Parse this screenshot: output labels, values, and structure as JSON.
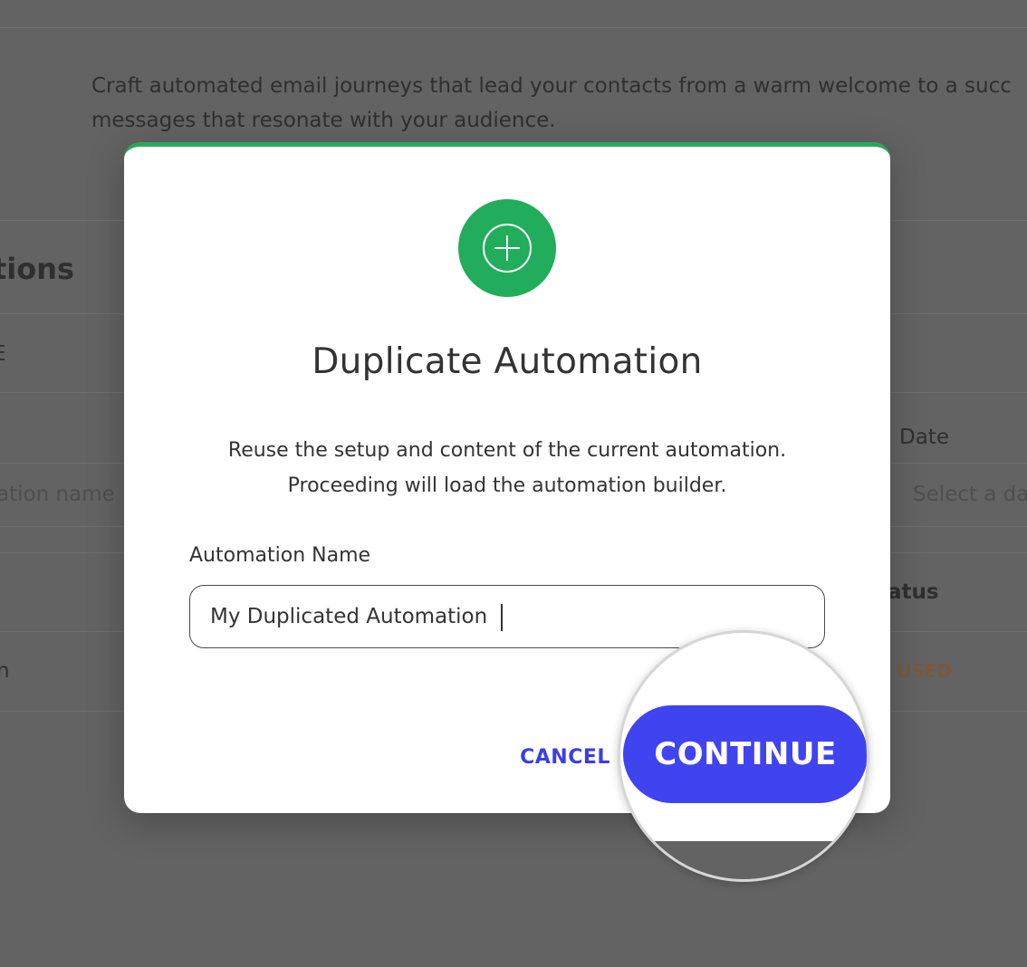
{
  "background": {
    "intro_line1": "Craft automated email journeys that lead your contacts from a warm welcome to a succ",
    "intro_line2": "messages that resonate with your audience.",
    "section_title": "tions",
    "filter_label_fragment": "E",
    "date_column": "Date",
    "name_search_placeholder": "ation name",
    "date_placeholder": "Select a da",
    "status_column": "atus",
    "row_name_fragment": "n",
    "row_status": "USED"
  },
  "modal": {
    "icon": "plus-circle-icon",
    "accent_color": "#21ad5b",
    "title": "Duplicate Automation",
    "description_line1": "Reuse the setup and content of the current automation.",
    "description_line2": "Proceeding will load the automation builder.",
    "field_label": "Automation Name",
    "field_value": "My Duplicated Automation",
    "cancel_label": "CANCEL",
    "continue_label": "CONTINUE",
    "primary_color": "#4043f0"
  }
}
